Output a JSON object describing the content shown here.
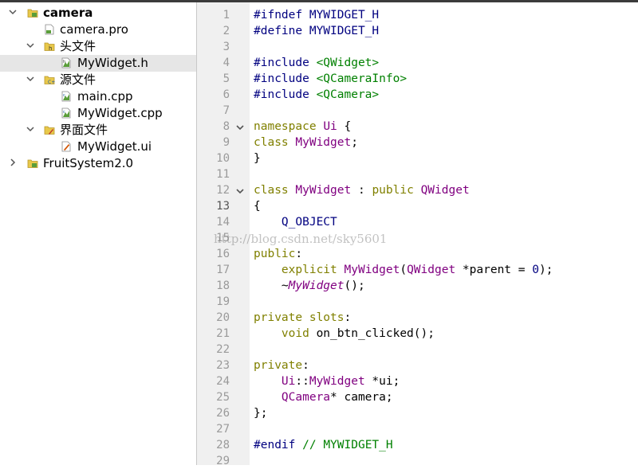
{
  "project_tree": {
    "items": [
      {
        "label": "camera",
        "icon": "project-folder-icon",
        "expanded": true,
        "bold": true
      },
      {
        "label": "camera.pro",
        "icon": "pro-file-icon"
      },
      {
        "label": "头文件",
        "icon": "headers-folder-icon",
        "expanded": true
      },
      {
        "label": "MyWidget.h",
        "icon": "header-file-icon",
        "selected": true
      },
      {
        "label": "源文件",
        "icon": "sources-folder-icon",
        "expanded": true
      },
      {
        "label": "main.cpp",
        "icon": "cpp-file-icon"
      },
      {
        "label": "MyWidget.cpp",
        "icon": "cpp-file-icon"
      },
      {
        "label": "界面文件",
        "icon": "forms-folder-icon",
        "expanded": true
      },
      {
        "label": "MyWidget.ui",
        "icon": "ui-file-icon"
      },
      {
        "label": "FruitSystem2.0",
        "icon": "project-folder-icon",
        "expanded": false
      }
    ]
  },
  "editor": {
    "current_line": 13,
    "lines": [
      "#ifndef MYWIDGET_H",
      "#define MYWIDGET_H",
      "",
      "#include <QWidget>",
      "#include <QCameraInfo>",
      "#include <QCamera>",
      "",
      "namespace Ui {",
      "class MyWidget;",
      "}",
      "",
      "class MyWidget : public QWidget",
      "{",
      "    Q_OBJECT",
      "",
      "public:",
      "    explicit MyWidget(QWidget *parent = 0);",
      "    ~MyWidget();",
      "",
      "private slots:",
      "    void on_btn_clicked();",
      "",
      "private:",
      "    Ui::MyWidget *ui;",
      "    QCamera* camera;",
      "};",
      "",
      "#endif // MYWIDGET_H",
      ""
    ],
    "line_numbers": [
      "1",
      "2",
      "3",
      "4",
      "5",
      "6",
      "7",
      "8",
      "9",
      "10",
      "11",
      "12",
      "13",
      "14",
      "15",
      "16",
      "17",
      "18",
      "19",
      "20",
      "21",
      "22",
      "23",
      "24",
      "25",
      "26",
      "27",
      "28",
      "29"
    ],
    "fold_markers": [
      8,
      12
    ]
  },
  "watermark": "http://blog.csdn.net/sky5601",
  "colors": {
    "keyword": "#808000",
    "preprocessor": "#000080",
    "string": "#008000",
    "class": "#800080",
    "comment": "#008000"
  }
}
